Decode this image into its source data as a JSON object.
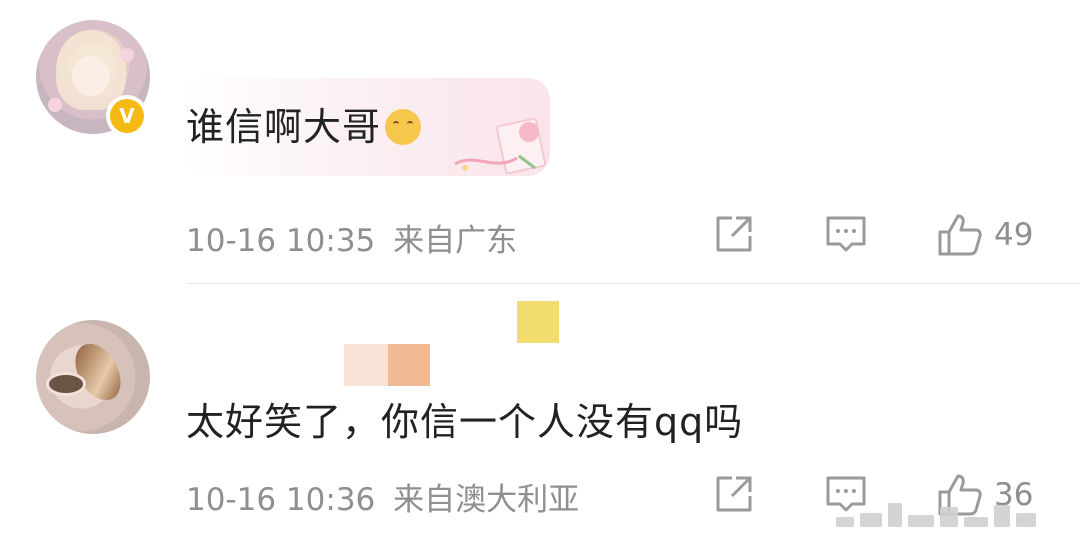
{
  "comments": [
    {
      "text": "谁信啊大哥",
      "emoji_icon": "hug-emoji-icon",
      "verified_badge": "V",
      "time": "10-16 10:35",
      "location": "来自广东",
      "like_count": "49"
    },
    {
      "text": "太好笑了，你信一个人没有qq吗",
      "time": "10-16 10:36",
      "location": "来自澳大利亚",
      "like_count": "36"
    }
  ],
  "icons": {
    "share": "share-icon",
    "reply": "comment-icon",
    "like": "thumbs-up-icon"
  },
  "colors": {
    "text": "#222222",
    "meta": "#8f8f8f",
    "badge": "#f5b914",
    "divider": "#ececec"
  }
}
